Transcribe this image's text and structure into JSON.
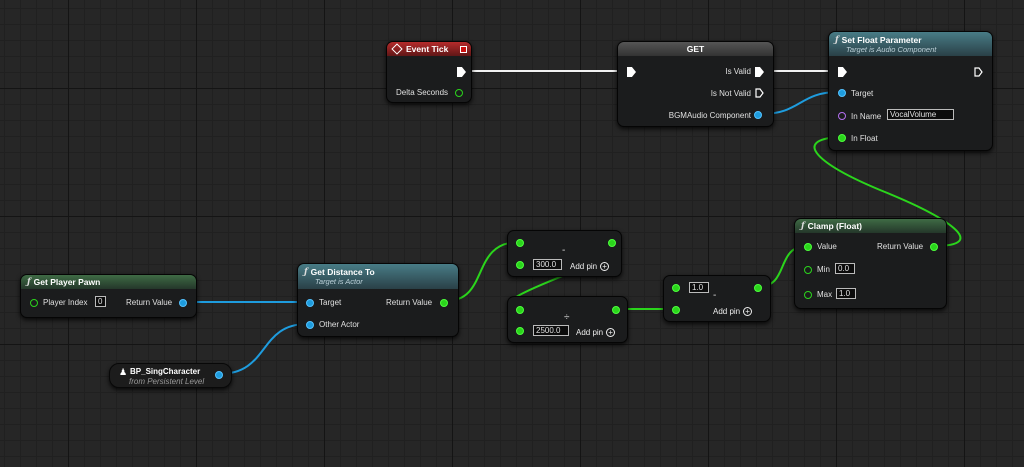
{
  "colors": {
    "exec": "#ffffff",
    "float_pin": "#2bd51c",
    "object_pin": "#1e9cde",
    "name_pin": "#b36ef0",
    "event_header": "#b52b2b",
    "function_header": "#3f6b45",
    "target_function_header": "#487c86"
  },
  "event_tick": {
    "title": "Event Tick",
    "delta_seconds": "Delta Seconds"
  },
  "get_node": {
    "title": "GET",
    "is_valid": "Is Valid",
    "is_not_valid": "Is Not Valid",
    "bgm": "BGMAudio Component"
  },
  "set_float": {
    "title": "Set Float Parameter",
    "subtitle": "Target is Audio Component",
    "target": "Target",
    "in_name": "In Name",
    "in_name_value": "VocalVolume",
    "in_float": "In Float"
  },
  "get_player_pawn": {
    "title": "Get Player Pawn",
    "player_index": "Player Index",
    "player_index_value": "0",
    "return_value": "Return Value"
  },
  "get_distance": {
    "title": "Get Distance To",
    "subtitle": "Target is Actor",
    "target": "Target",
    "other_actor": "Other Actor",
    "return_value": "Return Value"
  },
  "bp_sing": {
    "title": "BP_SingCharacter",
    "subtitle": "from Persistent Level"
  },
  "subtract_node": {
    "operator": "-",
    "value": "300.0",
    "add_pin": "Add pin"
  },
  "divide_node": {
    "operator": "÷",
    "value": "2500.0",
    "add_pin": "Add pin"
  },
  "one_minus_node": {
    "operator": "-",
    "value": "1.0",
    "add_pin": "Add pin"
  },
  "clamp": {
    "title": "Clamp (Float)",
    "value": "Value",
    "return_value": "Return Value",
    "min": "Min",
    "min_value": "0.0",
    "max": "Max",
    "max_value": "1.0"
  },
  "icons": {
    "function": "function-icon",
    "event": "event-icon",
    "actor": "actor-icon",
    "exec": "exec-pin-icon"
  }
}
